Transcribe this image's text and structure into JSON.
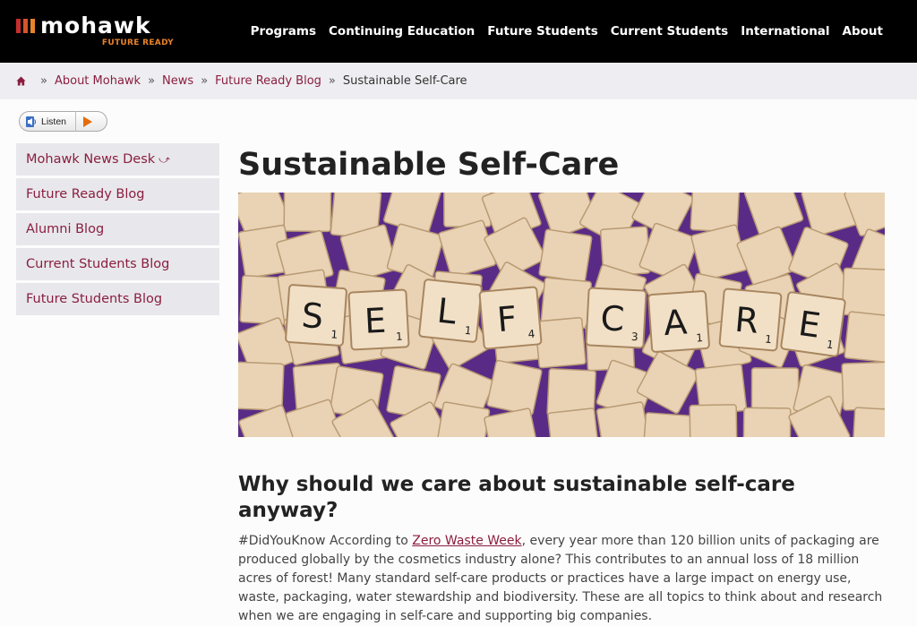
{
  "header": {
    "logo_text": "mohawk",
    "logo_tagline": "FUTURE READY",
    "logo_bar_colors": [
      "#c62e2e",
      "#d8552b",
      "#e8822a"
    ],
    "nav": [
      {
        "label": "Programs"
      },
      {
        "label": "Continuing Education"
      },
      {
        "label": "Future Students"
      },
      {
        "label": "Current Students"
      },
      {
        "label": "International"
      },
      {
        "label": "About"
      }
    ]
  },
  "breadcrumb": {
    "home_icon": "home-icon",
    "separator": "»",
    "items": [
      {
        "label": "About Mohawk"
      },
      {
        "label": "News"
      },
      {
        "label": "Future Ready Blog"
      }
    ],
    "current": "Sustainable Self-Care"
  },
  "listen": {
    "label": "Listen",
    "icon": "speaker-icon",
    "play_icon": "play-icon"
  },
  "sidebar": {
    "items": [
      {
        "label": "Mohawk News Desk",
        "arrow": "⤻"
      },
      {
        "label": "Future Ready Blog"
      },
      {
        "label": "Alumni Blog"
      },
      {
        "label": "Current Students Blog"
      },
      {
        "label": "Future Students Blog"
      }
    ]
  },
  "article": {
    "title": "Sustainable Self-Care",
    "hero_tiles": [
      "S",
      "E",
      "L",
      "F",
      "C",
      "A",
      "R",
      "E"
    ],
    "hero_tile_scores": [
      "1",
      "1",
      "1",
      "4",
      "3",
      "1",
      "1",
      "1"
    ],
    "subheading": "Why should we care about sustainable self-care anyway?",
    "paragraph_prefix": "#DidYouKnow According to ",
    "paragraph_link": "Zero Waste Week",
    "paragraph_suffix": ", every year more than 120 billion units of packaging are produced globally by the cosmetics industry alone? This contributes to an annual loss of 18 million acres of forest! Many standard self-care products or practices have a large impact on energy use, waste, packaging, water stewardship and biodiversity. These are all topics to think about and research when we are engaging in self-care and supporting big companies."
  },
  "colors": {
    "accent": "#8b1e3f",
    "header_bg": "#000000",
    "hero_bg": "#5a2b86",
    "tile": "#e9d3b4"
  }
}
